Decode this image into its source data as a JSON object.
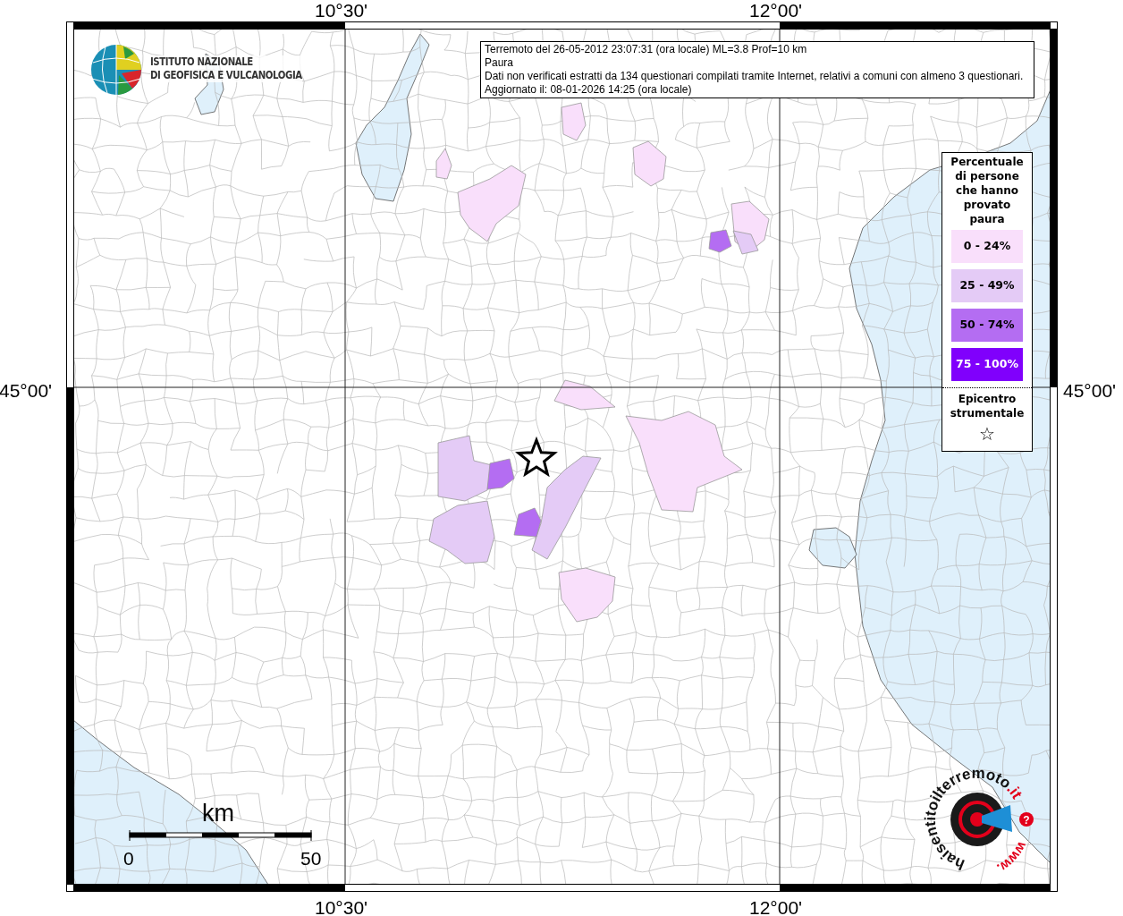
{
  "info_box": {
    "lines": [
      "Terremoto del 26-05-2012 23:07:31 (ora locale) ML=3.8 Prof=10 km",
      "Paura",
      "Dati non verificati estratti da 134 questionari compilati tramite Internet, relativi a comuni con almeno 3 questionari.",
      "Aggiornato il: 08-01-2026 14:25 (ora locale)"
    ]
  },
  "axis_labels": {
    "top": [
      "10°30'",
      "12°00'"
    ],
    "bottom": [
      "10°30'",
      "12°00'"
    ],
    "left": "45°00'",
    "right": "45°00'"
  },
  "institute_logo": {
    "lines": [
      "ISTITUTO NAZIONALE",
      "DI GEOFISICA E VULCANOLOGIA"
    ]
  },
  "legend": {
    "title": "Percentuale di persone che hanno provato paura",
    "classes": [
      {
        "label": "0 - 24%",
        "color": "#f9dffb"
      },
      {
        "label": "25 - 49%",
        "color": "#e4cbf6"
      },
      {
        "label": "50 - 74%",
        "color": "#b46df2"
      },
      {
        "label": "75 - 100%",
        "color": "#8000fc"
      }
    ],
    "epicenter_label": "Epicentro strumentale",
    "epicenter_symbol": "☆"
  },
  "scale_bar": {
    "unit": "km",
    "ticks": [
      "0",
      "50"
    ]
  },
  "site_logo": {
    "name": "haisentitoilterremoto",
    "domain": ".it",
    "prefix": "www.",
    "badge": "?"
  }
}
